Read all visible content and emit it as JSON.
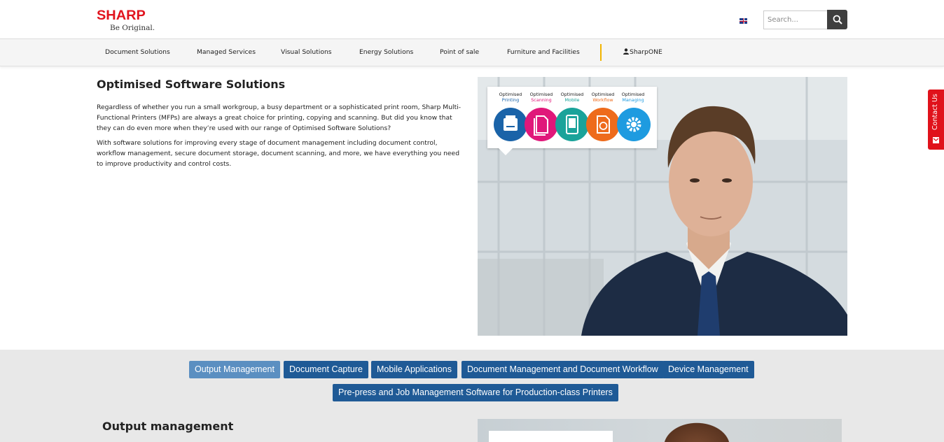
{
  "header": {
    "logo_text": "SHARP",
    "logo_tagline": "Be Original.",
    "search_placeholder": "Search...",
    "colors": {
      "brand_red": "#e1141e",
      "search_button": "#3f3f3f"
    }
  },
  "nav": {
    "items": [
      {
        "label": "Document Solutions"
      },
      {
        "label": "Managed Services"
      },
      {
        "label": "Visual Solutions"
      },
      {
        "label": "Energy Solutions"
      },
      {
        "label": "Point of sale"
      },
      {
        "label": "Furniture and Facilities"
      }
    ],
    "account_label": "SharpONE",
    "separator_color": "#f2b400"
  },
  "intro": {
    "title": "Optimised Software Solutions",
    "paragraph1": "Regardless of whether you run a small workgroup, a busy department or a sophisticated print room, Sharp Multi-Functional Printers (MFPs) are always a great choice for printing, copying and scanning. But did you know that they can do even more when they’re used with our range of Optimised Software Solutions?",
    "paragraph2": "With software solutions for improving every stage of document management including document control, workflow management, secure document storage, document scanning, and more, we have everything you need to improve productivity and control costs."
  },
  "hero_callout": {
    "items": [
      {
        "line1": "Optimised",
        "line2": "Printing",
        "color": "#1a63a8"
      },
      {
        "line1": "Optimised",
        "line2": "Scanning",
        "color": "#e0187a"
      },
      {
        "line1": "Optimised",
        "line2": "Mobile",
        "color": "#1aa39a"
      },
      {
        "line1": "Optimised",
        "line2": "Workflow",
        "color": "#ee6b1c"
      },
      {
        "line1": "Optimised",
        "line2": "Managing",
        "color": "#1e9be0"
      }
    ]
  },
  "tabs": {
    "row1": [
      {
        "label": "Output Management",
        "active": true
      },
      {
        "label": "Document Capture"
      },
      {
        "label": "Mobile Applications"
      },
      {
        "label": "Document Management and Document Workflow"
      },
      {
        "label": "Device Management"
      }
    ],
    "row2": [
      {
        "label": "Pre-press and Job Management Software for Production-class Printers"
      }
    ],
    "colors": {
      "tab": "#1f5a96",
      "tab_active": "#5b8fc1"
    }
  },
  "section": {
    "title": "Output management"
  },
  "contact_tab": {
    "label": "Contact Us",
    "color": "#e0121b"
  }
}
